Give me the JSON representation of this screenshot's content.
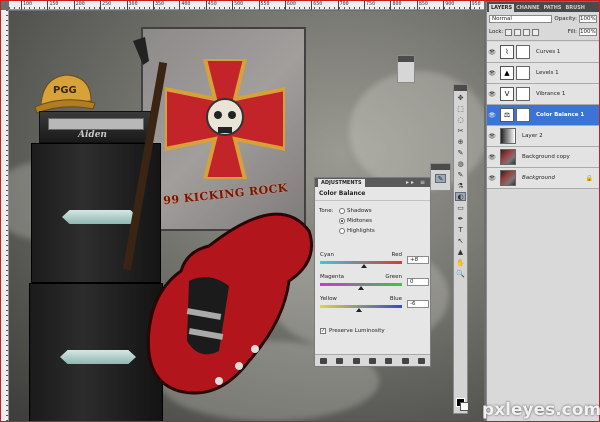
{
  "ruler": {
    "ticks": [
      "100",
      "150",
      "200",
      "250",
      "300",
      "350",
      "400",
      "450",
      "500",
      "550",
      "600",
      "650",
      "700",
      "750",
      "800",
      "850",
      "900",
      "950"
    ]
  },
  "poster": {
    "text": "99 KICKING ROCK"
  },
  "cap": {
    "text": "PGG"
  },
  "amp": {
    "logo": "Aiden"
  },
  "adjustments": {
    "tab_label": "ADJUSTMENTS",
    "tab_icons": "▸▸ ≡",
    "title": "Color Balance",
    "tone_label": "Tone:",
    "tone_options": [
      "Shadows",
      "Midtones",
      "Highlights"
    ],
    "tone_selected": "Midtones",
    "sliders": [
      {
        "left": "Cyan",
        "right": "Red",
        "value": "+8",
        "level": 0.54,
        "gradient": "#3ec7d8,#d23b3b"
      },
      {
        "left": "Magenta",
        "right": "Green",
        "value": "0",
        "level": 0.5,
        "gradient": "#c43bc8,#3ec44a"
      },
      {
        "left": "Yellow",
        "right": "Blue",
        "value": "-6",
        "level": 0.47,
        "gradient": "#e3d72f,#2f4bd8"
      }
    ],
    "preserve_label": "Preserve Luminosity",
    "preserve_checked": true
  },
  "layers_panel": {
    "tabs": [
      "LAYERS",
      "CHANNE",
      "PATHS",
      "BRUSH"
    ],
    "blend_mode": "Normal",
    "opacity_label": "Opacity:",
    "opacity_value": "100%",
    "lock_label": "Lock:",
    "fill_label": "Fill:",
    "fill_value": "100%",
    "layers": [
      {
        "name": "Curves 1",
        "kind": "adjustment",
        "icon": "⌇",
        "selected": false
      },
      {
        "name": "Levels 1",
        "kind": "adjustment",
        "icon": "▲",
        "selected": false
      },
      {
        "name": "Vibrance 1",
        "kind": "adjustment",
        "icon": "V",
        "selected": false
      },
      {
        "name": "Color Balance 1",
        "kind": "adjustment",
        "icon": "⚖",
        "selected": true
      },
      {
        "name": "Layer 2",
        "kind": "gradient",
        "icon": "",
        "selected": false
      },
      {
        "name": "Background copy",
        "kind": "image",
        "icon": "",
        "selected": false
      },
      {
        "name": "Background",
        "kind": "image",
        "icon": "",
        "selected": false,
        "locked": true
      }
    ]
  },
  "tools": [
    "✥",
    "⬚",
    "◌",
    "✂",
    "⊕",
    "✎",
    "◍",
    "✎",
    "⚗",
    "◐",
    "▭",
    "✒",
    "T",
    "↖",
    "▲",
    "✋",
    "🔍"
  ],
  "watermark": "pxleyes.com",
  "colors": {
    "selection": "#3b74d4",
    "frame": "#c81d1d"
  }
}
